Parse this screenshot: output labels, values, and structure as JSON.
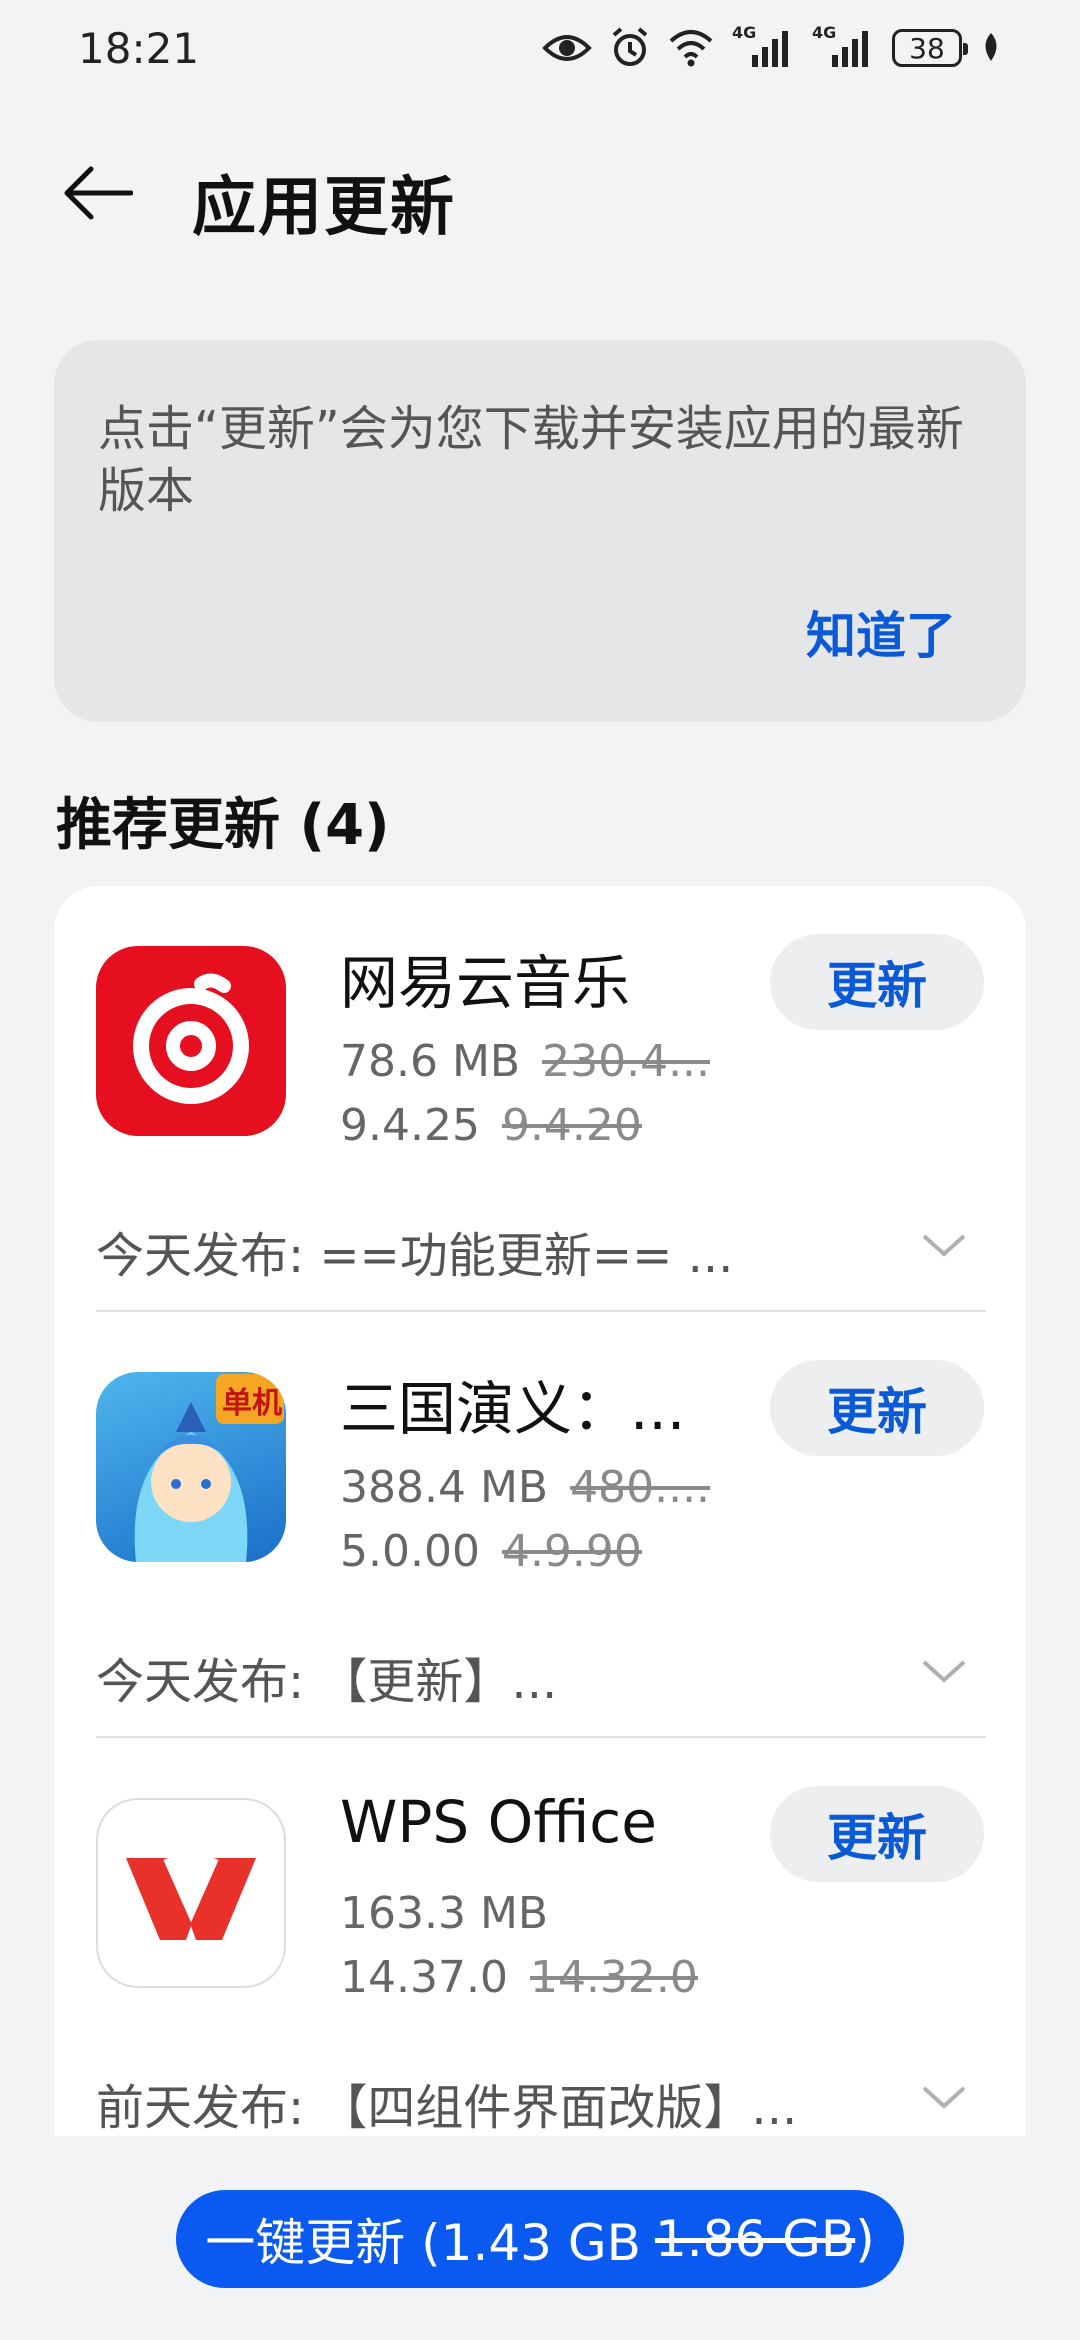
{
  "status_bar": {
    "time": "18:21",
    "network_tag_1": "4G",
    "network_tag_2": "4G",
    "battery": "38",
    "icons": [
      "eye-icon",
      "alarm-icon",
      "wifi-icon",
      "signal-icon",
      "signal-icon",
      "battery-icon",
      "leaf-icon"
    ]
  },
  "header": {
    "title": "应用更新",
    "back_icon": "back-arrow-icon"
  },
  "info_card": {
    "message": "点击“更新”会为您下载并安装应用的最新版本",
    "dismiss_label": "知道了"
  },
  "section": {
    "title": "推荐更新 (4)"
  },
  "apps": [
    {
      "name": "网易云音乐",
      "size": "78.6 MB",
      "old_size": "230.4...",
      "version": "9.4.25",
      "old_version": "9.4.20",
      "button": "更新",
      "release": "今天发布: ==功能更新== ..."
    },
    {
      "name": "三国演义：...",
      "size": "388.4 MB",
      "old_size": "480....",
      "version": "5.0.00",
      "old_version": "4.9.90",
      "button": "更新",
      "release": "今天发布: 【更新】...",
      "icon_badge": "单机"
    },
    {
      "name": "WPS Office",
      "size": "163.3 MB",
      "old_size": "",
      "version": "14.37.0",
      "old_version": "14.32.0",
      "button": "更新",
      "release": "前天发布: 【四组件界面改版】..."
    }
  ],
  "bottom_button": {
    "label": "一键更新 (1.43 GB",
    "old_size": "1.86 GB",
    "close_paren": ")"
  },
  "colors": {
    "accent": "#0a59d6",
    "primary_button": "#0a59f0",
    "background": "#f1f3f5"
  }
}
